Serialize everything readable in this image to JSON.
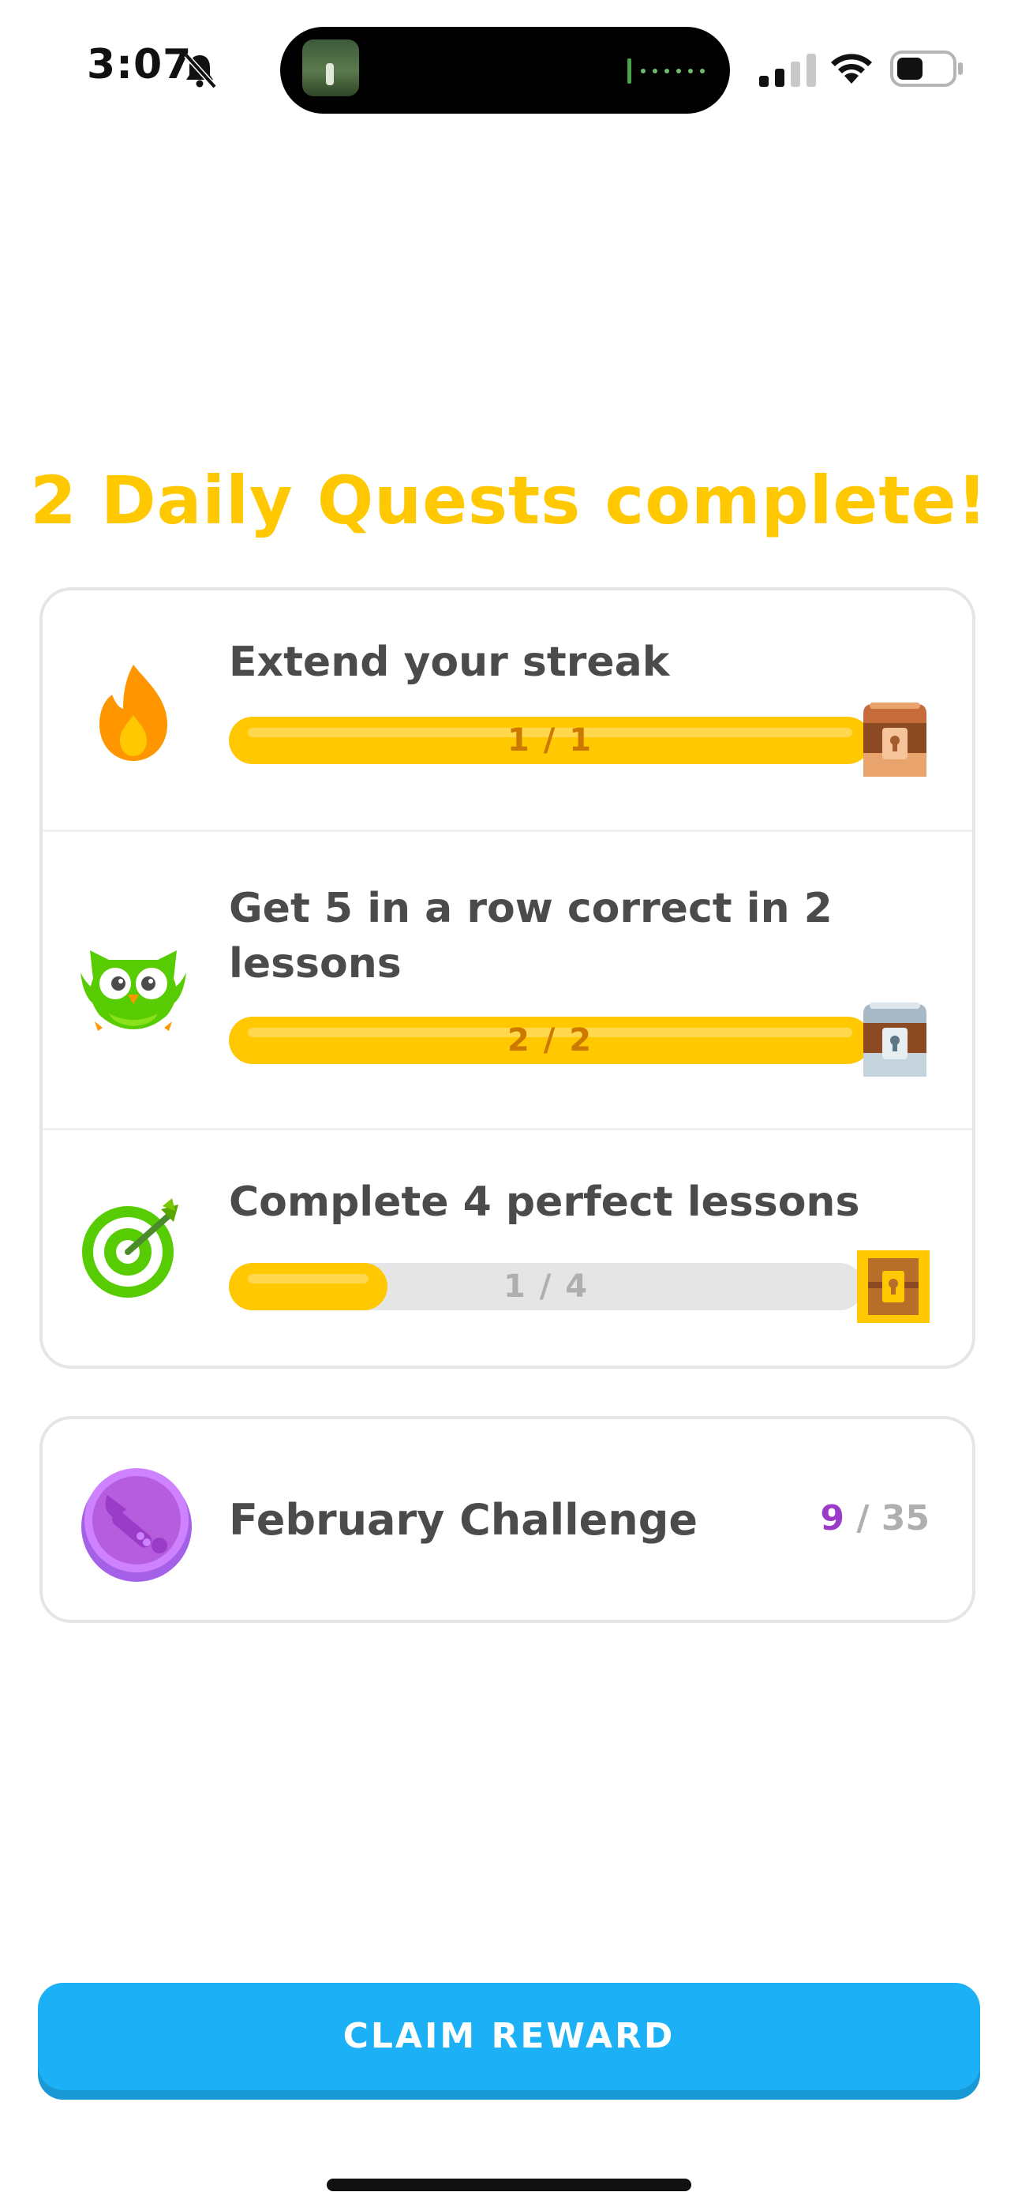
{
  "status_bar": {
    "time": "3:07",
    "icons": [
      "bell-slash-icon",
      "signal-icon",
      "wifi-icon",
      "battery-icon"
    ]
  },
  "title": "2 Daily Quests complete!",
  "colors": {
    "title": "#FFC800",
    "progress_fill": "#FFC800",
    "progress_track": "#E5E5E5",
    "button": "#1CB0F6",
    "challenge_accent": "#9B3CC8"
  },
  "quests": [
    {
      "icon": "flame-icon",
      "title": "Extend your streak",
      "progress_text": "1 / 1",
      "progress_fraction": 1.0,
      "chest": "bronze-chest-icon"
    },
    {
      "icon": "owl-icon",
      "title": "Get 5 in a row correct in 2 lessons",
      "progress_text": "2 / 2",
      "progress_fraction": 1.0,
      "chest": "silver-chest-icon"
    },
    {
      "icon": "target-icon",
      "title": "Complete 4 perfect lessons",
      "progress_text": "1 / 4",
      "progress_fraction": 0.25,
      "chest": "gold-chest-icon"
    }
  ],
  "challenge": {
    "icon": "trumpet-badge-icon",
    "title": "February Challenge",
    "current": "9",
    "separator": "/",
    "total": "35"
  },
  "button": {
    "label": "CLAIM REWARD"
  }
}
